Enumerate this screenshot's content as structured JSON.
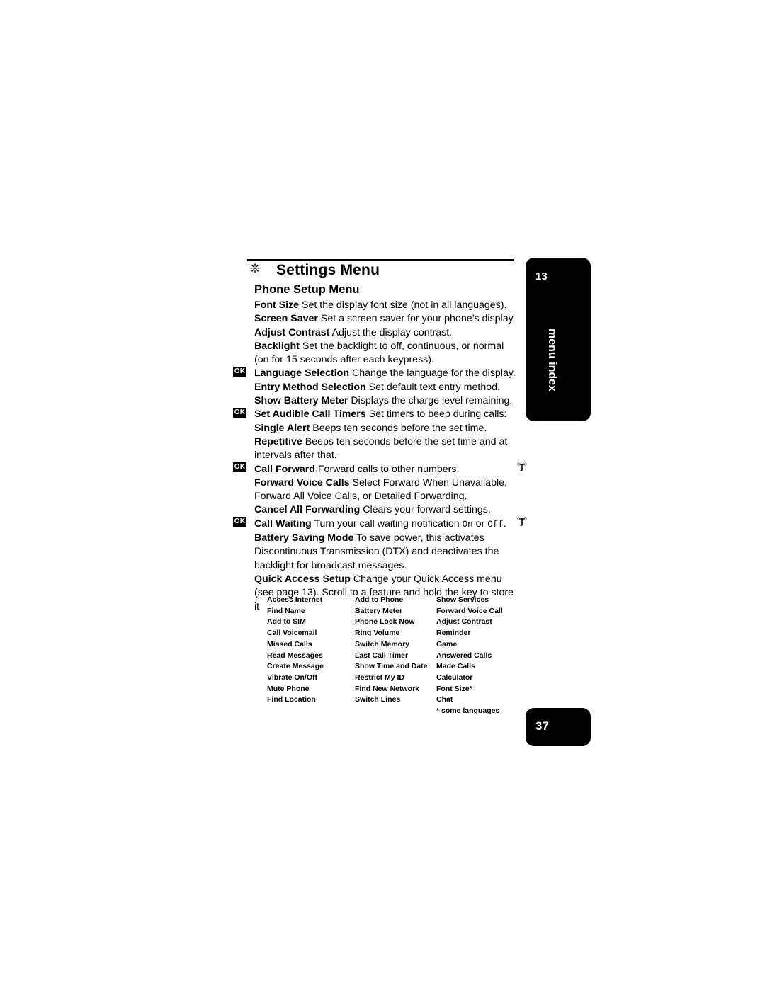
{
  "chapter": {
    "icon": "wand-icon",
    "title": "Settings Menu",
    "section": "Phone Setup Menu"
  },
  "thumb_tab": {
    "number": "13",
    "label": "menu index"
  },
  "page_number": "37",
  "entries": [
    {
      "id": "font-size",
      "indent": 1,
      "term": "Font Size",
      "desc": "Set the display font size (not in all languages).",
      "ok": false,
      "antenna": false
    },
    {
      "id": "screen-saver",
      "indent": 1,
      "term": "Screen Saver",
      "desc": "Set a screen saver for your phone’s display.",
      "ok": false,
      "antenna": false
    },
    {
      "id": "adjust-contrast",
      "indent": 1,
      "term": "Adjust Contrast",
      "desc": "Adjust the display contrast.",
      "ok": false,
      "antenna": false
    },
    {
      "id": "backlight",
      "indent": 1,
      "term": "Backlight",
      "desc": "Set the backlight to off, continuous, or normal (on for 15 seconds after each keypress).",
      "ok": false,
      "antenna": false
    },
    {
      "id": "language-selection",
      "indent": 1,
      "term": "Language Selection",
      "desc": "Change the language for the display.",
      "ok": true,
      "antenna": false
    },
    {
      "id": "entry-method-selection",
      "indent": 1,
      "term": "Entry Method Selection",
      "desc": "Set default text entry method.",
      "ok": false,
      "antenna": false
    },
    {
      "id": "show-battery-meter",
      "indent": 1,
      "term": "Show Battery Meter",
      "desc": "Displays the charge level remaining.",
      "ok": false,
      "antenna": false
    },
    {
      "id": "set-audible-call-timers",
      "indent": 1,
      "term": "Set Audible Call Timers",
      "desc": "Set timers to beep during calls:",
      "ok": true,
      "antenna": false
    },
    {
      "id": "single-alert",
      "indent": 2,
      "term": "Single Alert",
      "desc": "Beeps ten seconds before the set time.",
      "ok": false,
      "antenna": false
    },
    {
      "id": "repetitive",
      "indent": 2,
      "term": "Repetitive",
      "desc": "Beeps ten seconds before the set time and at intervals after that.",
      "ok": false,
      "antenna": false
    },
    {
      "id": "call-forward",
      "indent": 1,
      "term": "Call Forward",
      "desc": "Forward calls to other numbers.",
      "ok": true,
      "antenna": true
    },
    {
      "id": "forward-voice-calls",
      "indent": 2,
      "term": "Forward Voice Calls",
      "desc": "Select Forward When Unavailable, Forward All Voice Calls, or Detailed Forwarding.",
      "ok": false,
      "antenna": false
    },
    {
      "id": "cancel-all-forwarding",
      "indent": 2,
      "term": "Cancel All Forwarding",
      "desc": "Clears your forward settings.",
      "ok": false,
      "antenna": false
    },
    {
      "id": "call-waiting",
      "indent": 1,
      "term": "Call Waiting",
      "desc": "Turn your call waiting notification On or Off.",
      "ok": true,
      "antenna": true,
      "mono_words": [
        "On",
        "Off"
      ]
    },
    {
      "id": "battery-saving-mode",
      "indent": 1,
      "term": "Battery Saving Mode",
      "desc": "To save power, this activates Discontinuous Transmission (DTX) and deactivates the backlight for broadcast messages.",
      "ok": false,
      "antenna": false
    },
    {
      "id": "quick-access-setup",
      "indent": 1,
      "term": "Quick Access Setup",
      "desc": "Change your Quick Access menu (see page 13). Scroll to a feature and hold the key to store it",
      "ok": false,
      "antenna": false
    }
  ],
  "quick_access_table": {
    "rows": [
      [
        "Access Internet",
        "Add to Phone",
        "Show Services"
      ],
      [
        "Find Name",
        "Battery Meter",
        "Forward Voice Call"
      ],
      [
        "Add to SIM",
        "Phone Lock Now",
        "Adjust Contrast"
      ],
      [
        "Call Voicemail",
        "Ring Volume",
        "Reminder"
      ],
      [
        "Missed Calls",
        "Switch Memory",
        "Game"
      ],
      [
        "Read Messages",
        "Last Call Timer",
        "Answered Calls"
      ],
      [
        "Create Message",
        "Show Time and Date",
        "Made Calls"
      ],
      [
        "Vibrate On/Off",
        "Restrict My ID",
        "Calculator"
      ],
      [
        "Mute Phone",
        "Find New Network",
        "Font Size*"
      ],
      [
        "Find Location",
        "Switch Lines",
        "Chat"
      ]
    ],
    "footnote": "* some languages"
  },
  "ok_key_label": "OK"
}
